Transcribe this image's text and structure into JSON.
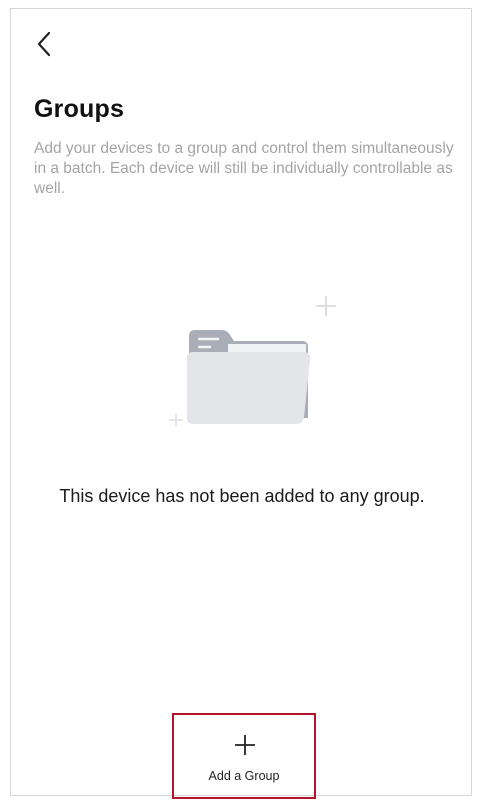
{
  "header": {
    "back_icon": "chevron-left-icon",
    "title": "Groups",
    "description": "Add your devices to a group and control them simultaneously in a batch. Each device will still be individually controllable as well."
  },
  "empty_state": {
    "illustration_icon": "folder-icon",
    "message": "This device has not been added to any group."
  },
  "actions": {
    "add_group_icon": "plus-icon",
    "add_group_label": "Add a Group"
  },
  "colors": {
    "highlight_border": "#b3142b",
    "description_text": "#a4a4a4",
    "folder_back": "#a9adb8",
    "folder_front": "#e4e5e9"
  }
}
